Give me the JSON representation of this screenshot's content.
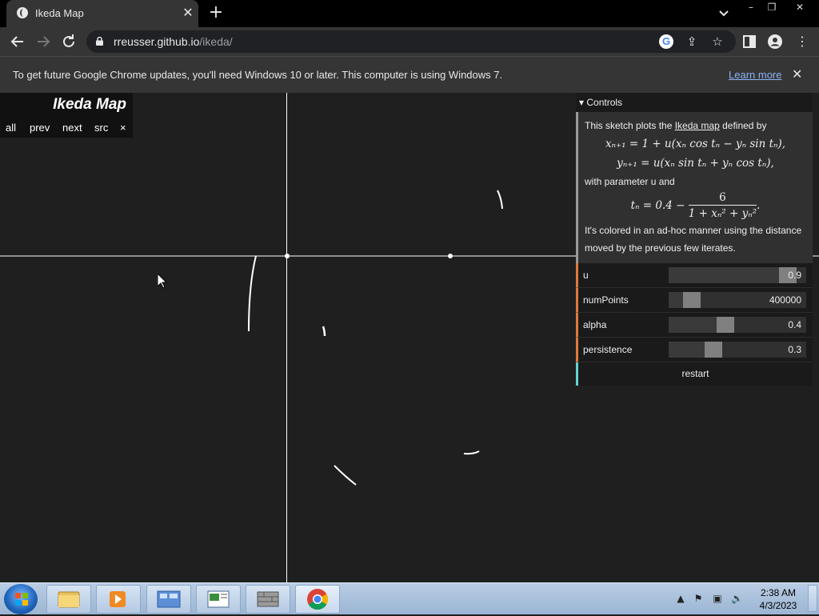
{
  "browser": {
    "tab_title": "Ikeda Map",
    "url_host": "rreusser.github.io",
    "url_path": "/ikeda/",
    "window_controls": [
      "–",
      "❐",
      "✕"
    ]
  },
  "infobar": {
    "message": "To get future Google Chrome updates, you'll need Windows 10 or later. This computer is using Windows 7.",
    "link": "Learn more"
  },
  "sketch_nav": {
    "title": "Ikeda Map",
    "links": [
      "all",
      "prev",
      "next",
      "src",
      "×"
    ]
  },
  "controls": {
    "header": "▾ Controls",
    "desc_intro": "This sketch plots the ",
    "desc_link": "Ikeda map",
    "desc_after": " defined by",
    "eq1": "xₙ₊₁ = 1 + u(xₙ cos tₙ − yₙ sin tₙ),",
    "eq2": "yₙ₊₁ = u(xₙ sin tₙ + yₙ cos tₙ),",
    "with_param": "with parameter u and",
    "eq3_lhs": "tₙ = 0.4 −",
    "eq3_num": "6",
    "eq3_den": "1 + xₙ² + yₙ²",
    "eq3_end": ".",
    "desc_end": "It's colored in an ad-hoc manner using the distance moved by the previous few iterates.",
    "sliders": [
      {
        "label": "u",
        "value": "0.9",
        "fraction": 0.92
      },
      {
        "label": "numPoints",
        "value": "400000",
        "fraction": 0.12
      },
      {
        "label": "alpha",
        "value": "0.4",
        "fraction": 0.4
      },
      {
        "label": "persistence",
        "value": "0.3",
        "fraction": 0.3
      }
    ],
    "restart_label": "restart"
  },
  "taskbar": {
    "time": "2:38 AM",
    "date": "4/3/2023",
    "apps": [
      "file-explorer",
      "media-player",
      "control-panel",
      "document-viewer",
      "firewall",
      "chrome"
    ]
  }
}
